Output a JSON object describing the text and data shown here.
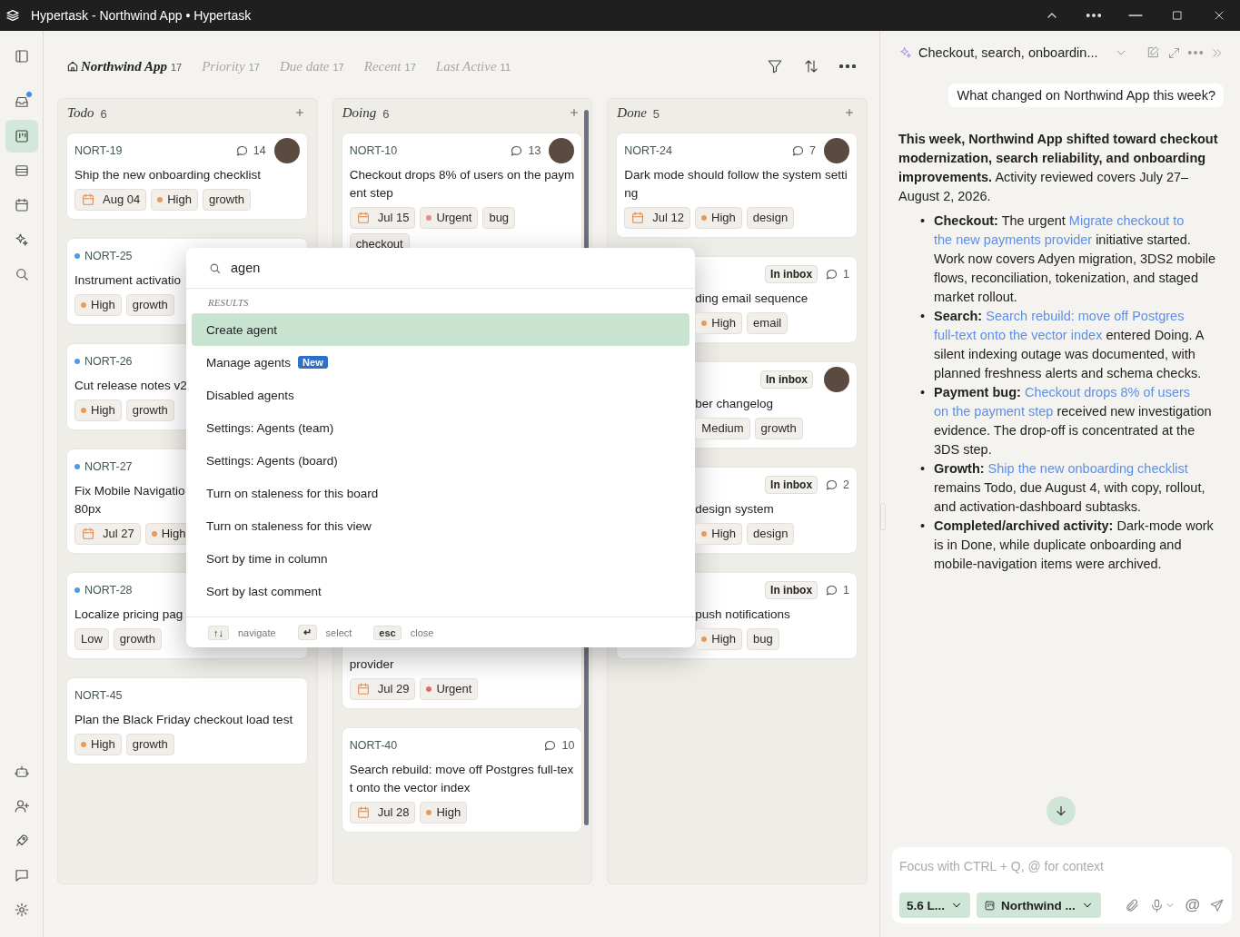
{
  "window": {
    "title": "Hypertask - Northwind App • Hypertask"
  },
  "rail": {
    "items": [
      {
        "selected": false,
        "notification": false
      },
      {
        "selected": false,
        "notification": true
      },
      {
        "selected": true,
        "notification": false
      },
      {
        "selected": false,
        "notification": false
      },
      {
        "selected": false,
        "notification": false
      },
      {
        "selected": false,
        "notification": false
      },
      {
        "selected": false,
        "notification": false
      }
    ]
  },
  "views": [
    {
      "label": "Northwind App",
      "count": "17",
      "selected": true
    },
    {
      "label": "Priority",
      "count": "17",
      "selected": false
    },
    {
      "label": "Due date",
      "count": "17",
      "selected": false
    },
    {
      "label": "Recent",
      "count": "17",
      "selected": false
    },
    {
      "label": "Last Active",
      "count": "11",
      "selected": false
    }
  ],
  "columns": [
    {
      "title": "Todo",
      "count": "6",
      "cards": [
        {
          "id": "NORT-19",
          "unread": false,
          "avatar": true,
          "comments": "14",
          "title": "Ship the new onboarding checklist",
          "date": "Aug 04",
          "priority": {
            "label": "High",
            "color": "#e59a5e"
          },
          "tags": [
            "growth"
          ]
        },
        {
          "id": "NORT-25",
          "unread": true,
          "avatar": false,
          "title": "Instrument activatio",
          "priority": {
            "label": "High",
            "color": "#e59a5e"
          },
          "tags": [
            "growth"
          ]
        },
        {
          "id": "NORT-26",
          "unread": true,
          "avatar": false,
          "title": "Cut release notes v2",
          "priority": {
            "label": "High",
            "color": "#e59a5e"
          },
          "tags": [
            "growth"
          ]
        },
        {
          "id": "NORT-27",
          "unread": true,
          "avatar": false,
          "title": "Fix Mobile Navigatio\n80px",
          "date": "Jul 27",
          "priority": {
            "label": "High",
            "color": "#e59a5e"
          }
        },
        {
          "id": "NORT-28",
          "unread": true,
          "avatar": false,
          "title": "Localize pricing pag",
          "priority": {
            "label": "Low"
          },
          "tags": [
            "growth"
          ]
        },
        {
          "id": "NORT-45",
          "unread": false,
          "avatar": false,
          "title": "Plan the Black Friday checkout load test",
          "priority": {
            "label": "High",
            "color": "#e59a5e"
          },
          "tags": [
            "growth"
          ]
        }
      ]
    },
    {
      "title": "Doing",
      "count": "6",
      "cards": [
        {
          "id": "NORT-10",
          "unread": false,
          "avatar": true,
          "comments": "13",
          "title": "Checkout drops 8% of users on the payment step",
          "date": "Jul 15",
          "priority": {
            "label": "Urgent",
            "color": "#e58a8a"
          },
          "tags": [
            "bug",
            "checkout"
          ]
        },
        {
          "unread": false,
          "avatar": false,
          "title": "provider",
          "date": "Jul 29",
          "priority": {
            "label": "Urgent",
            "color": "#e06b6b"
          }
        },
        {
          "id": "NORT-40",
          "unread": false,
          "avatar": false,
          "comments": "10",
          "title": "Search rebuild: move off Postgres full-text onto the vector index",
          "date": "Jul 28",
          "priority": {
            "label": "High",
            "color": "#e59a5e"
          }
        }
      ]
    },
    {
      "title": "Done",
      "count": "5",
      "cards": [
        {
          "id": "NORT-24",
          "unread": false,
          "avatar": true,
          "comments": "7",
          "title": "Dark mode should follow the system setting",
          "date": "Jul 12",
          "priority": {
            "label": "High",
            "color": "#e59a5e"
          },
          "tags": [
            "design"
          ]
        },
        {
          "unread": false,
          "avatar": false,
          "inbox_badge": "In inbox",
          "comments": "1",
          "title": "ding email sequence",
          "priority": {
            "label": "High",
            "color": "#e59a5e"
          },
          "tags": [
            "email"
          ]
        },
        {
          "unread": false,
          "avatar": true,
          "inbox_badge": "In inbox",
          "title": "ber changelog",
          "priority": {
            "label": "Medium"
          },
          "tags": [
            "growth"
          ]
        },
        {
          "unread": false,
          "avatar": false,
          "inbox_badge": "In inbox",
          "comments": "2",
          "title": "design system",
          "priority": {
            "label": "High",
            "color": "#e59a5e"
          },
          "tags": [
            "design"
          ]
        },
        {
          "unread": false,
          "avatar": false,
          "inbox_badge": "In inbox",
          "comments": "1",
          "title": "push notifications",
          "priority": {
            "label": "High",
            "color": "#e59a5e"
          },
          "tags": [
            "bug"
          ]
        }
      ]
    }
  ],
  "palette": {
    "query": "agen",
    "section": "RESULTS",
    "results": [
      {
        "label": "Create agent",
        "selected": true
      },
      {
        "label": "Manage agents",
        "selected": false,
        "badge": "New"
      },
      {
        "label": "Disabled agents",
        "selected": false
      },
      {
        "label": "Settings: Agents (team)",
        "selected": false
      },
      {
        "label": "Settings: Agents (board)",
        "selected": false
      },
      {
        "label": "Turn on staleness for this board",
        "selected": false
      },
      {
        "label": "Turn on staleness for this view",
        "selected": false
      },
      {
        "label": "Sort by time in column",
        "selected": false
      },
      {
        "label": "Sort by last comment",
        "selected": false
      }
    ],
    "hints": [
      {
        "key": "↑↓",
        "label": "navigate"
      },
      {
        "key": "↵",
        "label": "select"
      },
      {
        "key": "esc",
        "label": "close"
      }
    ]
  },
  "chat": {
    "title": "Checkout, search, onboardin...",
    "question": "What changed on Northwind App this week?",
    "summary": "**This week, Northwind App shifted toward checkout modernization, search reliability, and onboarding improvements.** Activity reviewed covers July 27–August 2, 2026.",
    "bullets": [
      {
        "marker": "•",
        "label": "Checkout:",
        "parts": [
          {
            "kind": "text",
            "text": "The urgent"
          },
          {
            "kind": "link",
            "text": "Migrate checkout to"
          },
          {
            "kind": "link",
            "text": "the new payments provider"
          },
          {
            "kind": "text",
            "text": "initiative started. Work now covers Adyen migration, 3DS2 mobile flows, reconciliation, tokenization, and staged market rollout."
          }
        ]
      },
      {
        "marker": "•",
        "label": "Search:",
        "parts": [
          {
            "kind": "link",
            "text": "Search rebuild: move off Postgres"
          },
          {
            "kind": "link",
            "text": "full-text onto the vector index"
          },
          {
            "kind": "text",
            "text": "entered Doing. A silent indexing outage was documented, with planned freshness alerts and schema checks."
          }
        ]
      },
      {
        "marker": "•",
        "label": "Payment bug:",
        "parts": [
          {
            "kind": "link",
            "text": "Checkout drops 8% of users"
          },
          {
            "kind": "link",
            "text": "on the payment step"
          },
          {
            "kind": "text",
            "text": "received new investigation evidence. The drop-off is concentrated at the 3DS step."
          }
        ]
      },
      {
        "marker": "•",
        "label": "Growth:",
        "parts": [
          {
            "kind": "link",
            "text": "Ship the new onboarding checklist"
          },
          {
            "kind": "text",
            "text": "remains Todo, due August 4, with copy, rollout, and activation-dashboard subtasks."
          }
        ]
      },
      {
        "marker": "•",
        "label": "Completed/archived activity:",
        "parts": [
          {
            "kind": "text",
            "text": "Dark-mode work is in Done, while duplicate onboarding and mobile-navigation items were archived."
          }
        ]
      }
    ],
    "composer": {
      "placeholder": "Focus with CTRL + Q, @ for context",
      "model": "5.6 L...",
      "board": "Northwind ...",
      "mention": "@"
    }
  }
}
